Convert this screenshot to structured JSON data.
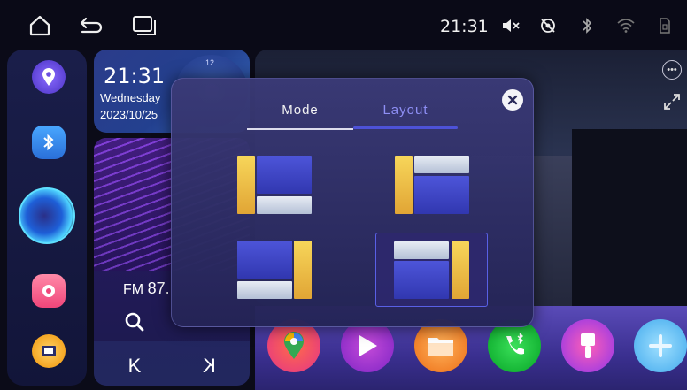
{
  "statusbar": {
    "time": "21:31",
    "icons": [
      "home-icon",
      "back-icon",
      "recent-apps-icon",
      "volume-muted-icon",
      "no-signal-icon",
      "bluetooth-icon",
      "wifi-icon",
      "sim-icon"
    ]
  },
  "dock": {
    "items": [
      "navigation-icon",
      "bluetooth-phone-icon",
      "voice-assistant-icon",
      "camera-icon",
      "app-drawer-icon"
    ]
  },
  "clock_widget": {
    "time": "21:31",
    "day": "Wednesday",
    "date": "2023/10/25",
    "dial_mark": "12"
  },
  "radio_widget": {
    "band": "FM",
    "frequency_partial": "87.",
    "prev_label": "K",
    "next_label": "K"
  },
  "modal": {
    "tabs": [
      {
        "label": "Mode",
        "active": false
      },
      {
        "label": "Layout",
        "active": true
      }
    ],
    "selected_option": 4,
    "options": [
      "layout-option-1",
      "layout-option-2",
      "layout-option-3",
      "layout-option-4"
    ]
  },
  "apps": [
    "google-maps-icon",
    "play-store-icon",
    "files-icon",
    "bluetooth-phone-app-icon",
    "paint-icon",
    "add-app-icon"
  ],
  "colors": {
    "accent": "#4d52d8",
    "tab_active_text": "#8e8ff5",
    "highlight_yellow": "#f7d65a"
  }
}
